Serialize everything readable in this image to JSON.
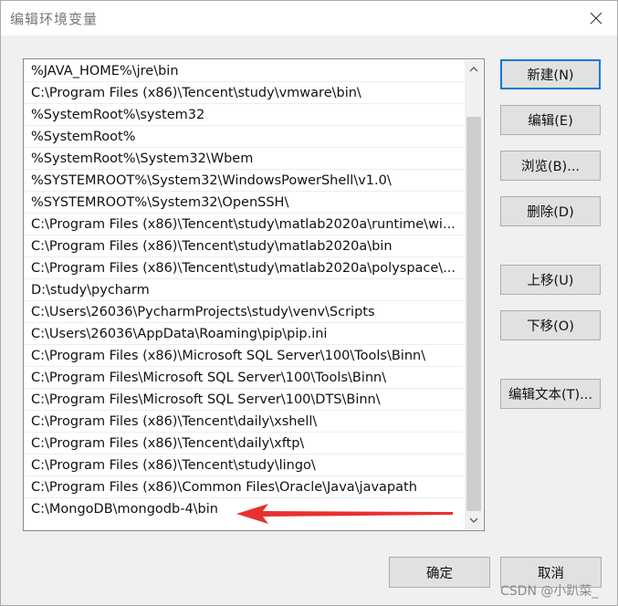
{
  "window": {
    "title": "编辑环境变量"
  },
  "path_list": [
    "%JAVA_HOME%\\jre\\bin",
    "C:\\Program Files (x86)\\Tencent\\study\\vmware\\bin\\",
    "%SystemRoot%\\system32",
    "%SystemRoot%",
    "%SystemRoot%\\System32\\Wbem",
    "%SYSTEMROOT%\\System32\\WindowsPowerShell\\v1.0\\",
    "%SYSTEMROOT%\\System32\\OpenSSH\\",
    "C:\\Program Files (x86)\\Tencent\\study\\matlab2020a\\runtime\\wi...",
    "C:\\Program Files (x86)\\Tencent\\study\\matlab2020a\\bin",
    "C:\\Program Files (x86)\\Tencent\\study\\matlab2020a\\polyspace\\...",
    "D:\\study\\pycharm",
    "C:\\Users\\26036\\PycharmProjects\\study\\venv\\Scripts",
    "C:\\Users\\26036\\AppData\\Roaming\\pip\\pip.ini",
    "C:\\Program Files (x86)\\Microsoft SQL Server\\100\\Tools\\Binn\\",
    "C:\\Program Files\\Microsoft SQL Server\\100\\Tools\\Binn\\",
    "C:\\Program Files\\Microsoft SQL Server\\100\\DTS\\Binn\\",
    "C:\\Program Files (x86)\\Tencent\\daily\\xshell\\",
    "C:\\Program Files (x86)\\Tencent\\daily\\xftp\\",
    "C:\\Program Files (x86)\\Tencent\\study\\lingo\\",
    "C:\\Program Files (x86)\\Common Files\\Oracle\\Java\\javapath",
    "C:\\MongoDB\\mongodb-4\\bin"
  ],
  "buttons": {
    "new": "新建(N)",
    "edit": "编辑(E)",
    "browse": "浏览(B)...",
    "delete": "删除(D)",
    "move_up": "上移(U)",
    "move_down": "下移(O)",
    "edit_text": "编辑文本(T)...",
    "ok": "确定",
    "cancel": "取消"
  },
  "icons": {
    "close": "close-icon",
    "scroll_up": "chevron-up-icon",
    "scroll_down": "chevron-down-icon",
    "annotation": "red-arrow-icon"
  },
  "colors": {
    "annotation_arrow": "#e8312f",
    "default_button_border": "#0078d7"
  },
  "watermark": "CSDN @小趴菜_"
}
